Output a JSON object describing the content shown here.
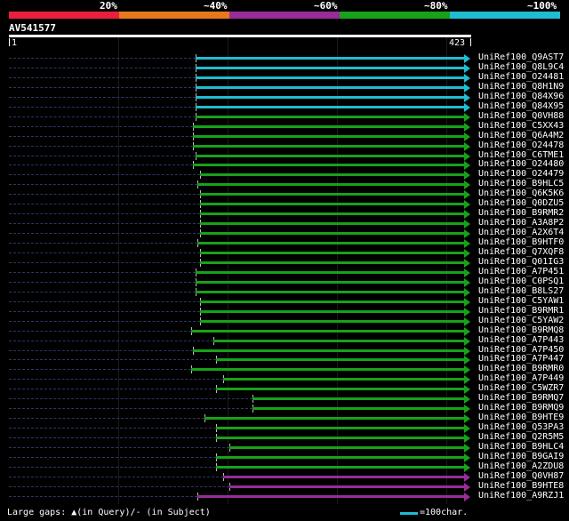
{
  "scale": {
    "labels": [
      "20%",
      "~40%",
      "~60%",
      "~80%",
      "~100%"
    ],
    "colors": [
      "#ea1f3d",
      "#e6781e",
      "#982c98",
      "#18a11a",
      "#1fbcd2"
    ]
  },
  "query": {
    "name": "AV541577",
    "start": "1",
    "end": "423"
  },
  "colors": {
    "cyan": "#1fbcd2",
    "green": "#18a11a",
    "purple": "#982c98"
  },
  "hits": [
    {
      "label": "UniRef100_Q9AST7",
      "color": "cyan",
      "start": 0.41
    },
    {
      "label": "UniRef100_Q8L9C4",
      "color": "cyan",
      "start": 0.41
    },
    {
      "label": "UniRef100_O24481",
      "color": "cyan",
      "start": 0.41
    },
    {
      "label": "UniRef100_Q8H1N9",
      "color": "cyan",
      "start": 0.41
    },
    {
      "label": "UniRef100_Q84X96",
      "color": "cyan",
      "start": 0.41
    },
    {
      "label": "UniRef100_Q84X95",
      "color": "cyan",
      "start": 0.41
    },
    {
      "label": "UniRef100_Q0VH88",
      "color": "green",
      "start": 0.41
    },
    {
      "label": "UniRef100_C5XX43",
      "color": "green",
      "start": 0.405
    },
    {
      "label": "UniRef100_Q6A4M2",
      "color": "green",
      "start": 0.405
    },
    {
      "label": "UniRef100_O24478",
      "color": "green",
      "start": 0.405
    },
    {
      "label": "UniRef100_C6TME1",
      "color": "green",
      "start": 0.41
    },
    {
      "label": "UniRef100_O24480",
      "color": "green",
      "start": 0.405
    },
    {
      "label": "UniRef100_O24479",
      "color": "green",
      "start": 0.42
    },
    {
      "label": "UniRef100_B9HLC5",
      "color": "green",
      "start": 0.415
    },
    {
      "label": "UniRef100_Q6K5K6",
      "color": "green",
      "start": 0.42
    },
    {
      "label": "UniRef100_Q0DZU5",
      "color": "green",
      "start": 0.42
    },
    {
      "label": "UniRef100_B9RMR2",
      "color": "green",
      "start": 0.42
    },
    {
      "label": "UniRef100_A3A8P2",
      "color": "green",
      "start": 0.42
    },
    {
      "label": "UniRef100_A2X6T4",
      "color": "green",
      "start": 0.42
    },
    {
      "label": "UniRef100_B9HTF0",
      "color": "green",
      "start": 0.415
    },
    {
      "label": "UniRef100_Q7XQF8",
      "color": "green",
      "start": 0.42
    },
    {
      "label": "UniRef100_Q01IG3",
      "color": "green",
      "start": 0.42
    },
    {
      "label": "UniRef100_A7P451",
      "color": "green",
      "start": 0.41
    },
    {
      "label": "UniRef100_C0PSQ1",
      "color": "green",
      "start": 0.41
    },
    {
      "label": "UniRef100_B8LS27",
      "color": "green",
      "start": 0.41
    },
    {
      "label": "UniRef100_C5YAW1",
      "color": "green",
      "start": 0.42
    },
    {
      "label": "UniRef100_B9RMR1",
      "color": "green",
      "start": 0.42
    },
    {
      "label": "UniRef100_C5YAW2",
      "color": "green",
      "start": 0.42
    },
    {
      "label": "UniRef100_B9RMQ8",
      "color": "green",
      "start": 0.4
    },
    {
      "label": "UniRef100_A7P443",
      "color": "green",
      "start": 0.45
    },
    {
      "label": "UniRef100_A7P450",
      "color": "green",
      "start": 0.405
    },
    {
      "label": "UniRef100_A7P447",
      "color": "green",
      "start": 0.455
    },
    {
      "label": "UniRef100_B9RMR0",
      "color": "green",
      "start": 0.4
    },
    {
      "label": "UniRef100_A7P449",
      "color": "green",
      "start": 0.47
    },
    {
      "label": "UniRef100_C5WZR7",
      "color": "green",
      "start": 0.455
    },
    {
      "label": "UniRef100_B9RMQ7",
      "color": "green",
      "start": 0.535
    },
    {
      "label": "UniRef100_B9RMQ9",
      "color": "green",
      "start": 0.535
    },
    {
      "label": "UniRef100_B9HTE9",
      "color": "green",
      "start": 0.43
    },
    {
      "label": "UniRef100_Q53PA3",
      "color": "green",
      "start": 0.455
    },
    {
      "label": "UniRef100_Q2R5M5",
      "color": "green",
      "start": 0.455
    },
    {
      "label": "UniRef100_B9HLC4",
      "color": "green",
      "start": 0.485
    },
    {
      "label": "UniRef100_B9GAI9",
      "color": "green",
      "start": 0.455
    },
    {
      "label": "UniRef100_A2ZDU8",
      "color": "green",
      "start": 0.455
    },
    {
      "label": "UniRef100_Q0VH87",
      "color": "purple",
      "start": 0.47
    },
    {
      "label": "UniRef100_B9HTE8",
      "color": "purple",
      "start": 0.485
    },
    {
      "label": "UniRef100_A9RZJ1",
      "color": "purple",
      "start": 0.415
    }
  ],
  "footer": {
    "gaps": "Large gaps: ▲(in Query)/- (in Subject)",
    "legend": "=100char."
  }
}
